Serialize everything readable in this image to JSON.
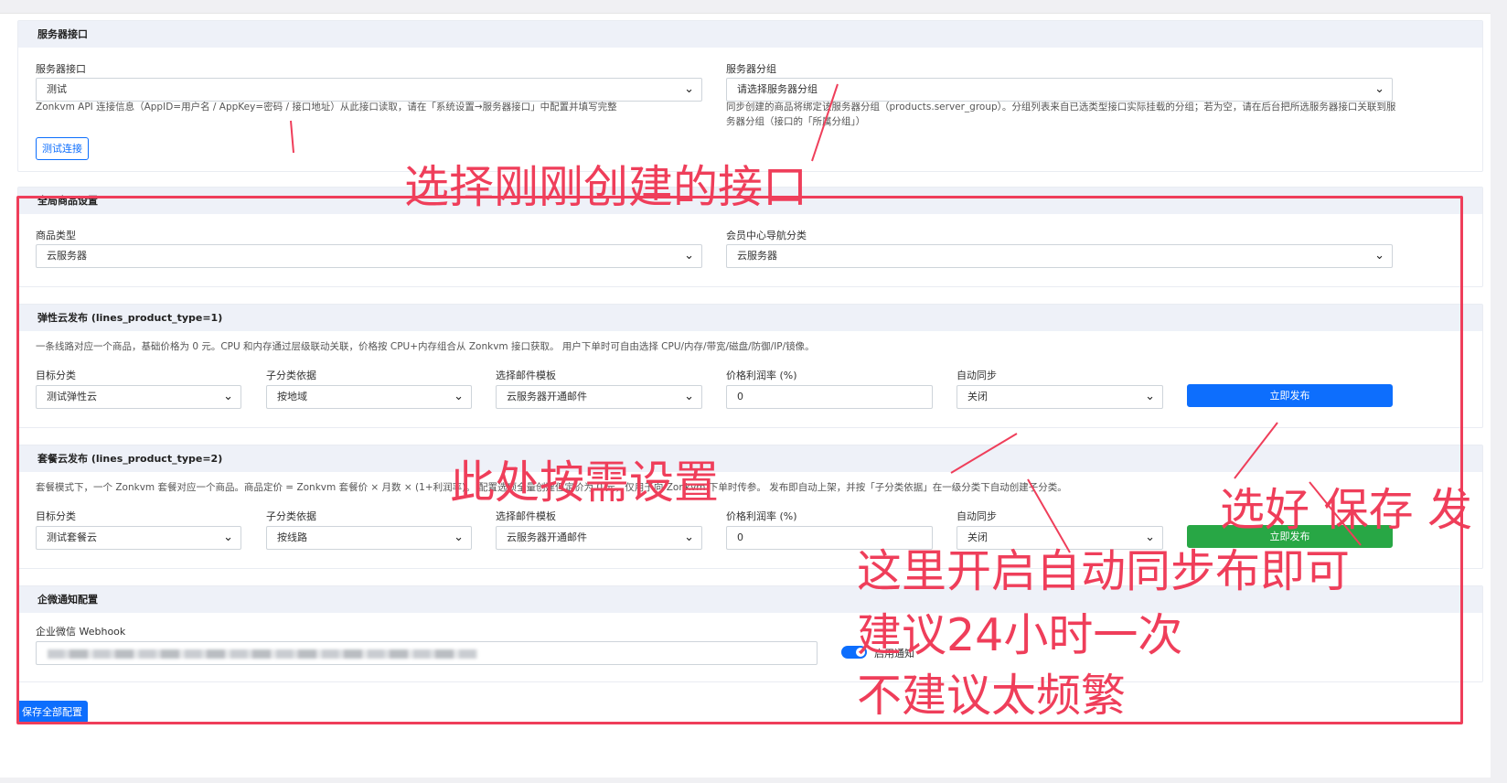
{
  "server_interface": {
    "title": "服务器接口",
    "interface_label": "服务器接口",
    "interface_value": "测试",
    "interface_help": "Zonkvm API 连接信息（AppID=用户名 / AppKey=密码 / 接口地址）从此接口读取，请在「系统设置→服务器接口」中配置并填写完整",
    "group_label": "服务器分组",
    "group_value": "请选择服务器分组",
    "group_help": "同步创建的商品将绑定该服务器分组（products.server_group）。分组列表来自已选类型接口实际挂载的分组；若为空，请在后台把所选服务器接口关联到服务器分组（接口的「所属分组」）",
    "test_button": "测试连接"
  },
  "global_settings": {
    "title": "全局商品设置",
    "product_type_label": "商品类型",
    "product_type_value": "云服务器",
    "nav_category_label": "会员中心导航分类",
    "nav_category_value": "云服务器"
  },
  "elastic": {
    "title": "弹性云发布 (lines_product_type=1)",
    "desc": "一条线路对应一个商品，基础价格为 0 元。CPU 和内存通过层级联动关联，价格按 CPU+内存组合从 Zonkvm 接口获取。 用户下单时可自由选择 CPU/内存/带宽/磁盘/防御/IP/镜像。",
    "target_label": "目标分类",
    "target_value": "测试弹性云",
    "sub_label": "子分类依据",
    "sub_value": "按地域",
    "mail_label": "选择邮件模板",
    "mail_value": "云服务器开通邮件",
    "profit_label": "价格利润率 (%)",
    "profit_value": "0",
    "sync_label": "自动同步",
    "sync_value": "关闭",
    "publish_button": "立即发布"
  },
  "package": {
    "title": "套餐云发布 (lines_product_type=2)",
    "desc": "套餐模式下，一个 Zonkvm 套餐对应一个商品。商品定价 = Zonkvm 套餐价 × 月数 × (1+利润率)。 配置选项全量创建但定价为 0 元，仅用于向 Zonkvm 下单时传参。 发布即自动上架，并按「子分类依据」在一级分类下自动创建子分类。",
    "target_label": "目标分类",
    "target_value": "测试套餐云",
    "sub_label": "子分类依据",
    "sub_value": "按线路",
    "mail_label": "选择邮件模板",
    "mail_value": "云服务器开通邮件",
    "profit_label": "价格利润率 (%)",
    "profit_value": "0",
    "sync_label": "自动同步",
    "sync_value": "关闭",
    "publish_button": "立即发布"
  },
  "wecom": {
    "title": "企微通知配置",
    "webhook_label": "企业微信 Webhook",
    "enable_label": "启用通知"
  },
  "save_all_button": "保存全部配置",
  "annotations": {
    "a1": "选择刚刚创建的接口",
    "a2": "此处按需设置",
    "a3": "选好 保存 发",
    "a4": "这里开启自动同步布即可",
    "a5": "建议24小时一次",
    "a6": "不建议太频繁"
  },
  "colors": {
    "primary": "#0d6efd",
    "success": "#28a745",
    "annotation": "#ef3e5a",
    "section_header": "#eef1f8"
  }
}
